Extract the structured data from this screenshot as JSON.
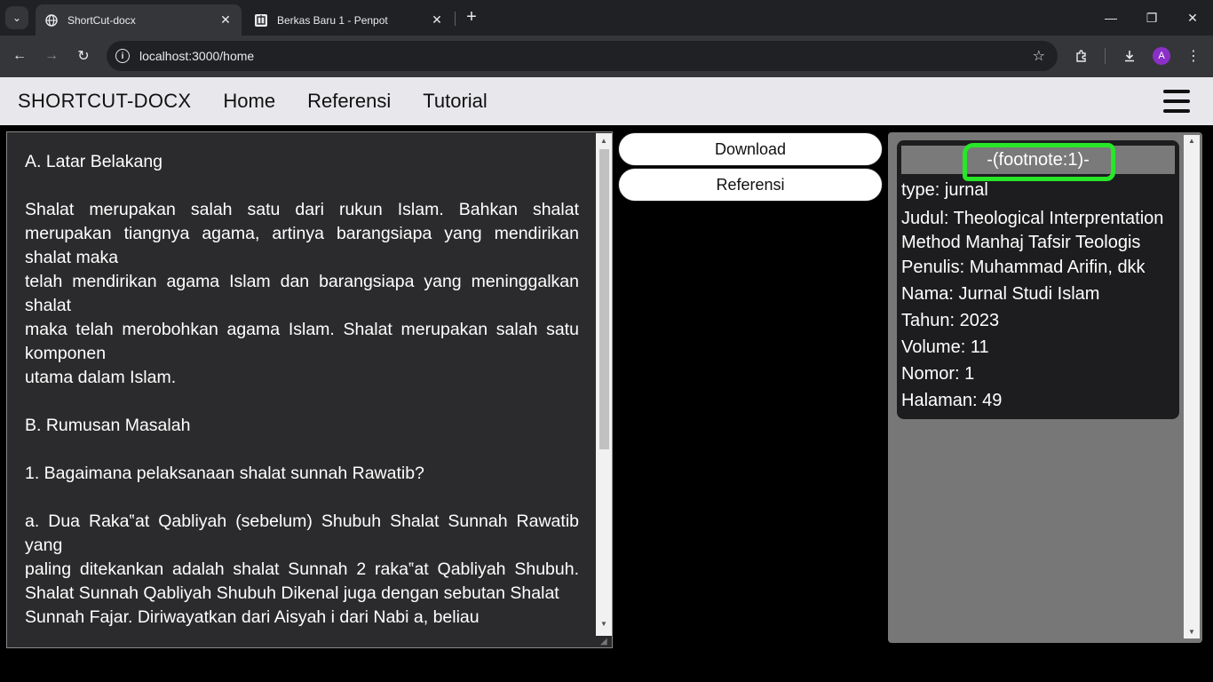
{
  "browser": {
    "tabs": [
      {
        "title": "ShortCut-docx",
        "active": true,
        "favicon": "globe-icon"
      },
      {
        "title": "Berkas Baru 1 - Penpot",
        "active": false,
        "favicon": "penpot-icon"
      }
    ],
    "url": "localhost:3000/home",
    "profile_initial": "A",
    "profile_color": "#8b2fc9"
  },
  "app": {
    "brand": "SHORTCUT-DOCX",
    "nav": [
      "Home",
      "Referensi",
      "Tutorial"
    ]
  },
  "editor": {
    "lines": [
      "A. Latar Belakang",
      "",
      "Shalat merupakan salah satu dari rukun Islam. Bahkan shalat merupakan tiangnya agama, artinya barangsiapa yang mendirikan shalat maka",
      "telah mendirikan agama Islam dan barangsiapa yang meninggalkan shalat",
      "maka telah merobohkan agama Islam. Shalat merupakan salah satu komponen",
      "utama dalam Islam.",
      "",
      "B. Rumusan Masalah",
      "",
      "1. Bagaimana pelaksanaan shalat sunnah Rawatib?",
      "",
      "a. Dua Raka‟at Qabliyah (sebelum) Shubuh Shalat Sunnah Rawatib yang",
      "paling ditekankan adalah shalat Sunnah 2 raka‟at Qabliyah Shubuh. Shalat Sunnah Qabliyah Shubuh Dikenal juga dengan sebutan Shalat",
      "Sunnah Fajar. Diriwayatkan dari Aisyah i dari Nabi a, beliau"
    ]
  },
  "buttons": {
    "download": "Download",
    "referensi": "Referensi"
  },
  "reference": {
    "header": "-(footnote:1)-",
    "fields": [
      "type: jurnal",
      "Judul: Theological Interprentation Method Manhaj Tafsir Teologis",
      "Penulis: Muhammad Arifin, dkk",
      "Nama: Jurnal Studi Islam",
      "Tahun: 2023",
      "Volume: 11",
      "Nomor: 1",
      "Halaman: 49"
    ],
    "highlight_color": "#28e628"
  }
}
